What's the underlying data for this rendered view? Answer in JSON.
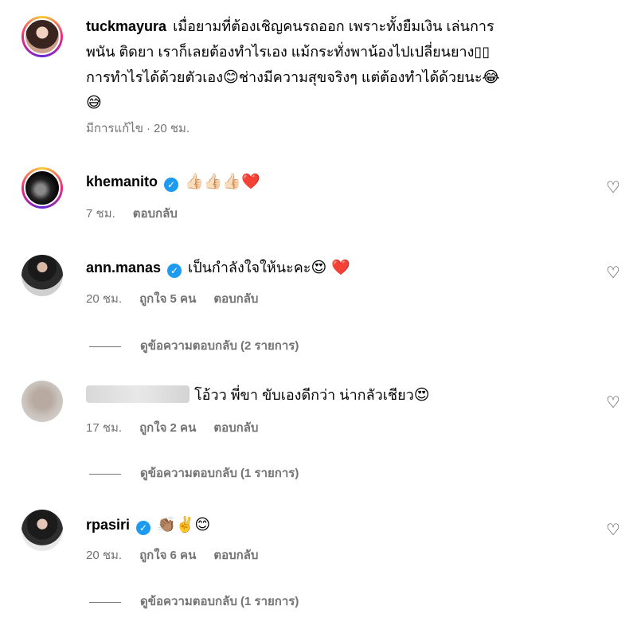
{
  "comments": [
    {
      "username": "tuckmayura",
      "lines": [
        "เมื่อยามที่ต้องเชิญคนรถออก เพราะทั้งยืมเงิน เล่นการ",
        "พนัน ติดยา เราก็เลยต้องทำไรเอง แม้กระทั่งพาน้องไปเปลี่ยนยาง▯▯",
        "การทำไรได้ด้วยตัวเอง",
        "ช่างมีความสุขจริงๆ แต่ต้องทำได้ด้วยนะ"
      ],
      "emoji_smile": "😊",
      "emoji_laugh": "😂",
      "emoji_sweat": "😅",
      "edited_label": "มีการแก้ไข",
      "time": "20 ชม."
    },
    {
      "username": "khemanito",
      "verified": true,
      "emojis": "👍🏻👍🏻👍🏻❤️",
      "time": "7 ชม.",
      "reply_label": "ตอบกลับ"
    },
    {
      "username": "ann.manas",
      "verified": true,
      "text": "เป็นกำลังใจให้นะคะ",
      "emojis": "😍 ❤️",
      "time": "20 ชม.",
      "likes": "ถูกใจ 5 คน",
      "reply_label": "ตอบกลับ",
      "view_replies": "ดูข้อความตอบกลับ (2 รายการ)"
    },
    {
      "text": "โอ้วว พี่ขา ขับเองดีกว่า น่ากลัวเชียว",
      "emojis": "😍",
      "time": "17 ชม.",
      "likes": "ถูกใจ 2 คน",
      "reply_label": "ตอบกลับ",
      "view_replies": "ดูข้อความตอบกลับ (1 รายการ)"
    },
    {
      "username": "rpasiri",
      "verified": true,
      "emojis": "👏🏽✌️😊",
      "time": "20 ชม.",
      "likes": "ถูกใจ 6 คน",
      "reply_label": "ตอบกลับ",
      "view_replies": "ดูข้อความตอบกลับ (1 รายการ)"
    }
  ],
  "icons": {
    "like": "heart-outline-icon",
    "verified": "verified-badge-icon"
  },
  "colors": {
    "verified": "#1d9bf0",
    "meta": "#737373",
    "heart_red": "#ed4956"
  }
}
